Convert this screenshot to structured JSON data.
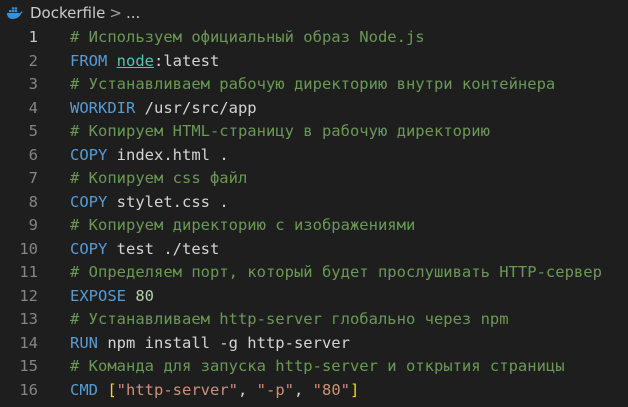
{
  "breadcrumb": {
    "file_icon": "docker-whale-icon",
    "file_name": "Dockerfile",
    "separator": ">",
    "ellipsis": "..."
  },
  "editor": {
    "active_line": 1,
    "lines": [
      {
        "number": "1",
        "tokens": [
          {
            "type": "comment",
            "text": "# Используем официальный образ Node.js"
          }
        ]
      },
      {
        "number": "2",
        "tokens": [
          {
            "type": "kw",
            "text": "FROM "
          },
          {
            "type": "link",
            "text": "node"
          },
          {
            "type": "text",
            "text": ":latest"
          }
        ]
      },
      {
        "number": "3",
        "tokens": [
          {
            "type": "comment",
            "text": "# Устанавливаем рабочую директорию внутри контейнера"
          }
        ]
      },
      {
        "number": "4",
        "tokens": [
          {
            "type": "kw",
            "text": "WORKDIR "
          },
          {
            "type": "text",
            "text": "/usr/src/app"
          }
        ]
      },
      {
        "number": "5",
        "tokens": [
          {
            "type": "comment",
            "text": "# Копируем HTML-страницу в рабочую директорию"
          }
        ]
      },
      {
        "number": "6",
        "tokens": [
          {
            "type": "kw",
            "text": "COPY "
          },
          {
            "type": "text",
            "text": "index.html ."
          }
        ]
      },
      {
        "number": "7",
        "tokens": [
          {
            "type": "comment",
            "text": "# Копируем css файл"
          }
        ]
      },
      {
        "number": "8",
        "tokens": [
          {
            "type": "kw",
            "text": "COPY "
          },
          {
            "type": "text",
            "text": "stylet.css ."
          }
        ]
      },
      {
        "number": "9",
        "tokens": [
          {
            "type": "comment",
            "text": "# Копируем директорию с изображениями"
          }
        ]
      },
      {
        "number": "10",
        "tokens": [
          {
            "type": "kw",
            "text": "COPY "
          },
          {
            "type": "text",
            "text": "test ./test"
          }
        ]
      },
      {
        "number": "11",
        "tokens": [
          {
            "type": "comment",
            "text": "# Определяем порт, который будет прослушивать HTTP-сервер"
          }
        ]
      },
      {
        "number": "12",
        "tokens": [
          {
            "type": "kw",
            "text": "EXPOSE "
          },
          {
            "type": "num",
            "text": "80"
          }
        ]
      },
      {
        "number": "13",
        "tokens": [
          {
            "type": "comment",
            "text": "# Устанавливаем http-server глобально через npm"
          }
        ]
      },
      {
        "number": "14",
        "tokens": [
          {
            "type": "kw",
            "text": "RUN "
          },
          {
            "type": "text",
            "text": "npm install -g http-server"
          }
        ]
      },
      {
        "number": "15",
        "tokens": [
          {
            "type": "comment",
            "text": "# Команда для запуска http-server и открытия страницы"
          }
        ]
      },
      {
        "number": "16",
        "tokens": [
          {
            "type": "kw",
            "text": "CMD "
          },
          {
            "type": "bracket",
            "text": "["
          },
          {
            "type": "str",
            "text": "\"http-server\""
          },
          {
            "type": "text",
            "text": ", "
          },
          {
            "type": "str",
            "text": "\"-p\""
          },
          {
            "type": "text",
            "text": ", "
          },
          {
            "type": "str",
            "text": "\"80\""
          },
          {
            "type": "bracket",
            "text": "]"
          }
        ]
      }
    ]
  }
}
